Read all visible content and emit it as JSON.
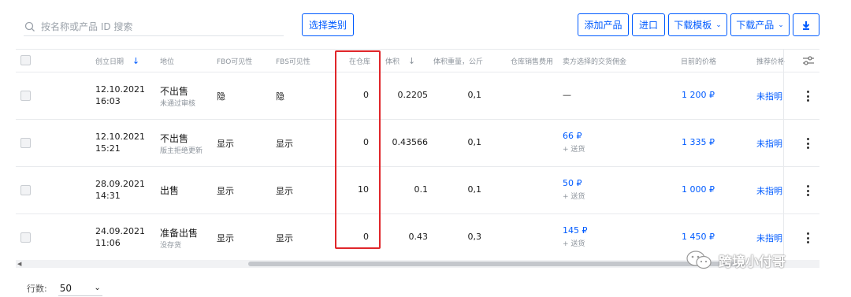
{
  "toolbar": {
    "search_placeholder": "按名称或产品 ID 搜索",
    "category_button": "选择类别",
    "add_product": "添加产品",
    "import": "进口",
    "download_template": "下载模板",
    "download_products": "下载产品"
  },
  "table": {
    "headers": {
      "created": "创立日期",
      "status": "地位",
      "fbo": "FBO可见性",
      "fbs": "FBS可见性",
      "stock": "在仓库",
      "volume": "体积",
      "weight": "体积重量，公斤",
      "storage_fee": "仓库销售费用",
      "commission": "卖方选择的交货佣金",
      "price": "目前的价格",
      "recommended": "推荐价格"
    },
    "rows": [
      {
        "date": "12.10.2021",
        "time": "16:03",
        "status": "不出售",
        "sub": "未通过审核",
        "fbo": "隐",
        "fbs": "隐",
        "stock": "0",
        "volume": "0.2205",
        "weight": "0,1",
        "commission": "—",
        "commission_sub": "",
        "price": "1 200 ₽",
        "rec": "未指明"
      },
      {
        "date": "12.10.2021",
        "time": "15:21",
        "status": "不出售",
        "sub": "版主拒绝更新",
        "fbo": "显示",
        "fbs": "显示",
        "stock": "0",
        "volume": "0.43566",
        "weight": "0,1",
        "commission": "66 ₽",
        "commission_sub": "+ 送货",
        "price": "1 335 ₽",
        "rec": "未指明"
      },
      {
        "date": "28.09.2021",
        "time": "14:31",
        "status": "出售",
        "sub": "",
        "fbo": "显示",
        "fbs": "显示",
        "stock": "10",
        "volume": "0.1",
        "weight": "0,1",
        "commission": "50 ₽",
        "commission_sub": "+ 送货",
        "price": "1 000 ₽",
        "rec": "未指明"
      },
      {
        "date": "24.09.2021",
        "time": "11:06",
        "status": "准备出售",
        "sub": "没存货",
        "fbo": "显示",
        "fbs": "显示",
        "stock": "0",
        "volume": "0.43",
        "weight": "0,3",
        "commission": "145 ₽",
        "commission_sub": "+ 送货",
        "price": "1 450 ₽",
        "rec": "未指明"
      }
    ]
  },
  "footer": {
    "rows_label": "行数:",
    "rows_value": "50"
  },
  "watermark": {
    "text": "跨境小付哥"
  },
  "colors": {
    "accent": "#005bff",
    "highlight": "#e0262a"
  }
}
